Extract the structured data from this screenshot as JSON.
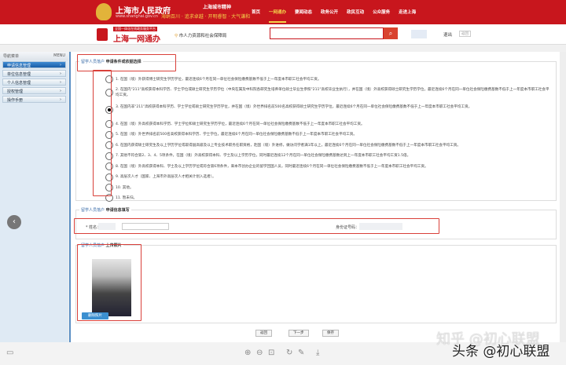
{
  "header": {
    "site_title": "上海市人民政府",
    "site_url": "www.shanghai.gov.cn",
    "slogan_title": "上海城市精神",
    "slogan": "海纳百川 · 追求卓越 · 开明睿智 · 大气谦和",
    "nav": [
      "首页",
      "一网通办",
      "要闻动态",
      "政务公开",
      "政民互动",
      "公众服务",
      "走进上海"
    ],
    "nav_active": 1
  },
  "subheader": {
    "tag": "全国一体化在线政务服务平台",
    "title": "上海一网通办",
    "department": "市人力资源和社会保障局",
    "search_placeholder": "",
    "logout": "退出",
    "back_top": "返回"
  },
  "sidebar": {
    "title": "导航菜单",
    "menu": "MENU",
    "items": [
      "申请信息管理",
      "单位信息管理",
      "个人信息管理",
      "授权管理",
      "操作手册"
    ],
    "active": 0
  },
  "section1": {
    "prefix": "留学人员落户",
    "title": "申请条件或依据选择",
    "selected": 2,
    "options": [
      "1. 在国（境）外获得博士研究生学历学位，最近连续6个月在同一单位社会保险缴费基数不低于上一年度本市职工社会平均工资。",
      "2. 在国内\"211\"高校获得本科学历、学士学位或硕士研究生学历学位（中央在属及中科院各研究生培养单位硕士毕业生参照\"211\"高校毕业生执行），并在国（境）外高校获得硕士研究生学历学位，最近连续6个月在同一单位社会保险缴费基数不低于上一年度本市职工社会平均工资。",
      "3. 在国内非\"211\"高校获得本科学历、学士学位或硕士研究生学历学位，并在国（境）外世界排名前500名高校获得硕士研究生学历学位，最近连续6个月在同一单位社会保险缴费基数不低于上一年度本市职工社会平均工资。",
      "4. 在国（境）外高校获得本科学历、学士学位和硕士研究生学历学位，最近连续6个月在同一单位社会保险缴费基数不低于上一年度本市职工社会平均工资。",
      "5. 在国（境）外世界排名前500名高校获得本科学历、学士学位，最近连续6个月在同一单位社会保险缴费基数不低于上一年度本市职工社会平均工资。",
      "6. 在国内获得硕士研究生及以上学历学位或取得副高级及以上专业技术职务任职资格，赴国（境）外进修，做访问学者满1年以上，最近连续6个月在同一单位社会保险缴费基数不低于上一年度本市职工社会平均工资。",
      "7. 其他不符合第2、3、4、5项条件，在国（境）外高校获得本科、学士及以上学历学位，同时最近连续12个月在同一单位社会保险缴费基数达到上一年度本市职工社会平均工资1.5倍。",
      "8. 在国（境）外高校获得本科、学士及以上学历学位或符合第6项条件，来本市创办企业的留学回国人员，同时最近连续6个月在同一单位社会保险缴费基数不低于上一年度本市职工社会平均工资。",
      "9. 高层次人才（国家、上海市外高层次人才相关计划入选者）。",
      "10. 其他。",
      "11. 暂未归。"
    ]
  },
  "section2": {
    "prefix": "留学人员落户",
    "title": "申请信息填写",
    "name_label": "* 姓名：",
    "id_label": "身份证号码："
  },
  "section3": {
    "prefix": "留学人员落户",
    "title": "上传照片",
    "delete_photo": "删除照片"
  },
  "actions": {
    "back": "返回",
    "next": "下一步",
    "save": "保存"
  },
  "watermark": {
    "line1": "知乎 @初心联盟",
    "line2": "头条 @初心联盟"
  }
}
